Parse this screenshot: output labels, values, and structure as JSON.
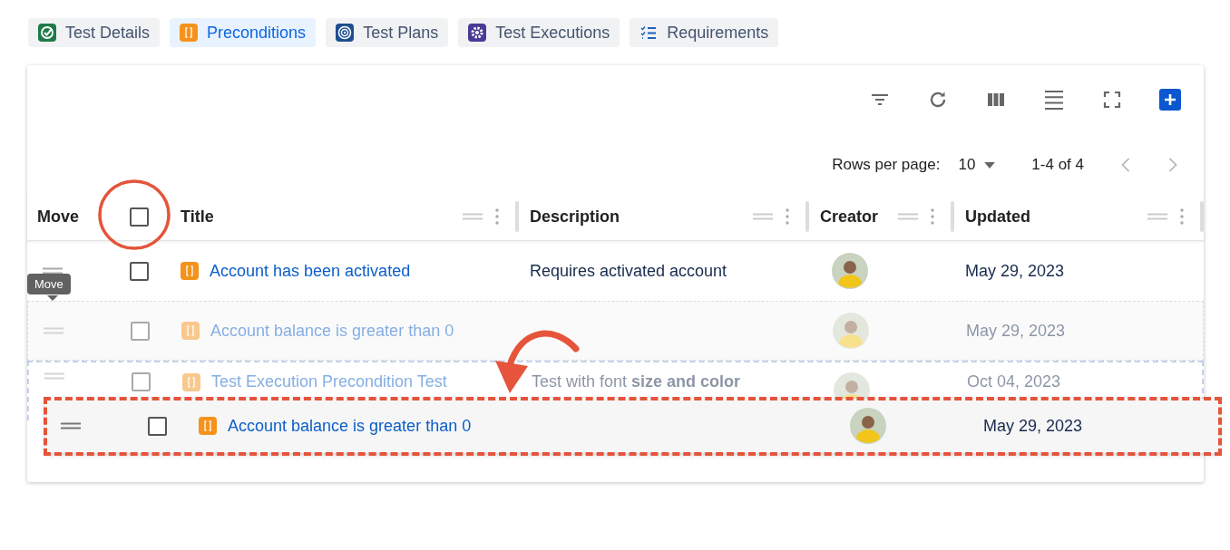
{
  "tabs": [
    {
      "label": "Test Details",
      "kind": "check",
      "selected": false
    },
    {
      "label": "Preconditions",
      "kind": "bracket",
      "selected": true
    },
    {
      "label": "Test Plans",
      "kind": "target",
      "selected": false
    },
    {
      "label": "Test Executions",
      "kind": "gear",
      "selected": false
    },
    {
      "label": "Requirements",
      "kind": "checklist",
      "selected": false
    }
  ],
  "pagination": {
    "rows_per_page_label": "Rows per page:",
    "rows_per_page": "10",
    "range": "1-4 of 4"
  },
  "table": {
    "columns": [
      {
        "label": "Move"
      },
      {
        "label": "Title",
        "kind": "resizable"
      },
      {
        "label": "Description",
        "kind": "resizable"
      },
      {
        "label": "Creator",
        "kind": "resizable"
      },
      {
        "label": "Updated",
        "kind": "resizable"
      }
    ],
    "select_all": {
      "checked": false
    },
    "rows": [
      {
        "kind": "normal",
        "checked": false,
        "title": "Account has been activated",
        "description": "Requires activated account",
        "updated": "May 29, 2023"
      },
      {
        "kind": "ghost",
        "checked": false,
        "title": "Account balance is greater than 0",
        "updated": "May 29, 2023"
      },
      {
        "kind": "target",
        "checked": false,
        "title": "Test Execution Precondition Test",
        "description": "Test with font **size and color**",
        "updated": "Oct 04, 2023"
      }
    ],
    "dragged_row": {
      "checked": false,
      "title": "Account balance is greater than 0",
      "updated": "May 29, 2023"
    }
  },
  "tooltip": "Move",
  "annotations": [
    {
      "kind": "circle"
    },
    {
      "kind": "arrow"
    },
    {
      "kind": "dashed-frame"
    }
  ]
}
